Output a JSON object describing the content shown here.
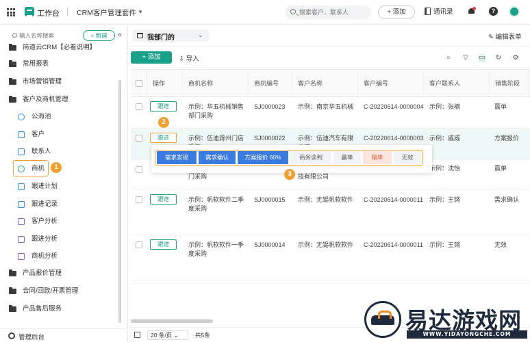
{
  "topbar": {
    "app_name": "工作台",
    "suite_name": "CRM客户管理套件",
    "search_placeholder": "搜索客户、联系人",
    "add_label": "+ 添加",
    "contacts_label": "通讯录"
  },
  "sidebar": {
    "search_placeholder": "输入名称搜索",
    "new_label": "+ 新建",
    "items": [
      {
        "label": "简道云CRM【必看说明】"
      },
      {
        "label": "常用报表"
      },
      {
        "label": "市场营销管理"
      },
      {
        "label": "客户及商机管理"
      },
      {
        "label": "公海池"
      },
      {
        "label": "客户"
      },
      {
        "label": "联系人"
      },
      {
        "label": "商机"
      },
      {
        "label": "跟进计划"
      },
      {
        "label": "跟进记录"
      },
      {
        "label": "客户分析"
      },
      {
        "label": "跟进分析"
      },
      {
        "label": "商机分析"
      },
      {
        "label": "产品报价管理"
      },
      {
        "label": "合同/回款/开票管理"
      },
      {
        "label": "产品售后服务"
      }
    ],
    "footer_label": "管理后台"
  },
  "content": {
    "view_name": "我部门的",
    "edit_form": "编辑表单",
    "add_label": "+ 添加",
    "import_label": "导入"
  },
  "table": {
    "headers": [
      "操作",
      "商机名称",
      "商机编号",
      "客户名称",
      "客户编号",
      "客户联系人",
      "销售阶段"
    ],
    "follow_label": "跟进",
    "rows": [
      {
        "name1": "示例：华五机械销售",
        "name2": "部门采购",
        "code": "SJ0000023",
        "cust1": "示例：南京华五机械",
        "cust2": "",
        "cust_code": "C-20220614-0000004",
        "contact": "示例：张楠",
        "stage": "赢单"
      },
      {
        "name1": "示例：伍迪滁州门店",
        "name2": "采购",
        "code": "SJ0000022",
        "cust1": "示例：伍迪汽车有限",
        "cust2": "公司",
        "cust_code": "C-20220614-0000003",
        "contact": "示例：戚威",
        "stage": "方案报价"
      },
      {
        "name1": "",
        "name2": "门采购",
        "code": "",
        "cust1": "",
        "cust2": "技有限公司",
        "cust_code": "",
        "contact": "示例：沈怡",
        "stage": "赢单"
      },
      {
        "name1": "示例：帆软软件二季",
        "name2": "度采购",
        "code": "SJ0000015",
        "cust1": "示例：无锡帆软软件",
        "cust2": "",
        "cust_code": "C-20220614-0000011",
        "contact": "示例：王锵",
        "stage": "需求确认"
      },
      {
        "name1": "示例：帆软软件一季",
        "name2": "度采购",
        "code": "SJ0000014",
        "cust1": "示例：无锡帆软软件",
        "cust2": "",
        "cust_code": "C-20220614-0000011",
        "contact": "示例：王锵",
        "stage": "无效"
      }
    ]
  },
  "stages": [
    "需求发现",
    "需求确认",
    "方案报价 60%",
    "商务谈判",
    "赢单",
    "输单",
    "无效"
  ],
  "annotations": [
    "1",
    "2",
    "3"
  ],
  "pagination": {
    "page_size": "20 条/页",
    "total": "共5条"
  },
  "watermark": {
    "title": "易达游戏网",
    "url": "WWW.YIDAYONGCHE.COM"
  },
  "colors": {
    "accent": "#1aa189",
    "highlight": "#f0a030",
    "stage_done": "#3a7be0",
    "lose": "#e8603c"
  }
}
